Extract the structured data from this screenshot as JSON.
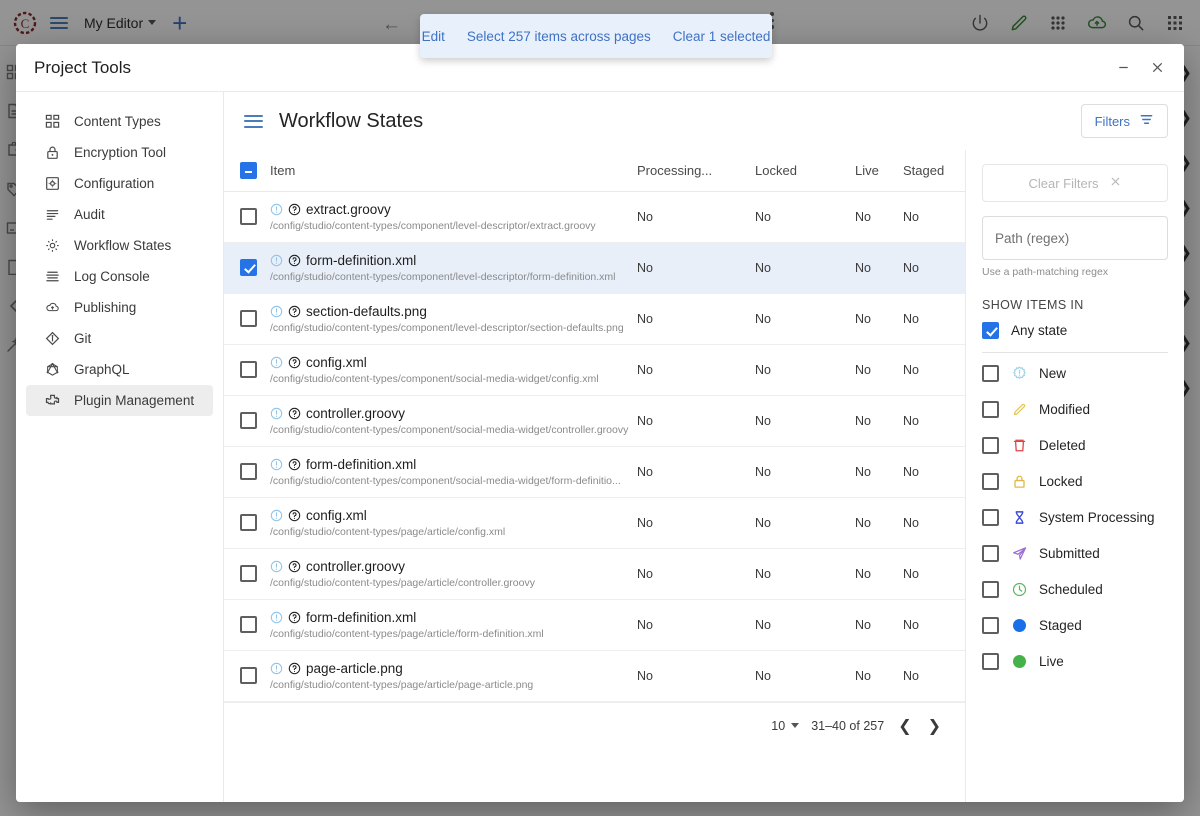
{
  "background": {
    "brand_icon": "crafter-logo-icon",
    "menu_icon": "hamburger-icon",
    "editor_label": "My Editor",
    "add_label": "+",
    "back_icon": "arrow-left-icon",
    "kebab_icon": "more-vertical-icon",
    "top_icons": [
      "power-icon",
      "pencil-icon",
      "grid-dots-icon",
      "cloud-upload-icon",
      "search-icon",
      "apps-grid-icon"
    ],
    "left_rail_icons": [
      "dashboard-icon",
      "document-icon",
      "puzzle-icon",
      "tag-icon",
      "card-icon",
      "page-icon",
      "chevron-left-icon",
      "wand-icon"
    ],
    "right_rail_icons": [
      "chevron-right-icon",
      "chevron-right-icon",
      "chevron-right-icon",
      "chevron-right-icon",
      "chevron-right-icon",
      "chevron-right-icon",
      "chevron-right-icon",
      "chevron-right-icon"
    ],
    "accent_blue": "#3f72c4",
    "accent_green": "#4a8a4a"
  },
  "bulk_toast": {
    "edit_label": "Edit",
    "select_all_label": "Select 257 items across pages",
    "clear_label": "Clear 1 selected",
    "background": "#e8f0fb",
    "text_color": "#3f72c4"
  },
  "dialog": {
    "title": "Project Tools",
    "minimize_label": "–",
    "close_label": "✕"
  },
  "sidebar": {
    "items": [
      {
        "label": "Content Types",
        "icon": "content-types-icon",
        "active": false
      },
      {
        "label": "Encryption Tool",
        "icon": "lock-icon",
        "active": false
      },
      {
        "label": "Configuration",
        "icon": "settings-square-icon",
        "active": false
      },
      {
        "label": "Audit",
        "icon": "list-icon",
        "active": false
      },
      {
        "label": "Workflow States",
        "icon": "gear-icon",
        "active": false
      },
      {
        "label": "Log Console",
        "icon": "log-lines-icon",
        "active": false
      },
      {
        "label": "Publishing",
        "icon": "cloud-upload-icon",
        "active": false
      },
      {
        "label": "Git",
        "icon": "git-diamond-icon",
        "active": false
      },
      {
        "label": "GraphQL",
        "icon": "graphql-icon",
        "active": false
      },
      {
        "label": "Plugin Management",
        "icon": "plugin-puzzle-icon",
        "active": true
      }
    ]
  },
  "main": {
    "menu_icon": "hamburger-icon",
    "title": "Workflow States",
    "filters_button": {
      "label": "Filters",
      "icon": "filter-icon"
    }
  },
  "table": {
    "header_checkbox_state": "indeterminate",
    "columns": [
      "Item",
      "Processing...",
      "Locked",
      "Live",
      "Staged"
    ],
    "rows": [
      {
        "name": "extract.groovy",
        "path": "/config/studio/content-types/component/level-descriptor/extract.groovy",
        "processing": "No",
        "locked": "No",
        "live": "No",
        "staged": "No",
        "selected": false
      },
      {
        "name": "form-definition.xml",
        "path": "/config/studio/content-types/component/level-descriptor/form-definition.xml",
        "processing": "No",
        "locked": "No",
        "live": "No",
        "staged": "No",
        "selected": true
      },
      {
        "name": "section-defaults.png",
        "path": "/config/studio/content-types/component/level-descriptor/section-defaults.png",
        "processing": "No",
        "locked": "No",
        "live": "No",
        "staged": "No",
        "selected": false
      },
      {
        "name": "config.xml",
        "path": "/config/studio/content-types/component/social-media-widget/config.xml",
        "processing": "No",
        "locked": "No",
        "live": "No",
        "staged": "No",
        "selected": false
      },
      {
        "name": "controller.groovy",
        "path": "/config/studio/content-types/component/social-media-widget/controller.groovy",
        "processing": "No",
        "locked": "No",
        "live": "No",
        "staged": "No",
        "selected": false
      },
      {
        "name": "form-definition.xml",
        "path": "/config/studio/content-types/component/social-media-widget/form-definitio...",
        "processing": "No",
        "locked": "No",
        "live": "No",
        "staged": "No",
        "selected": false
      },
      {
        "name": "config.xml",
        "path": "/config/studio/content-types/page/article/config.xml",
        "processing": "No",
        "locked": "No",
        "live": "No",
        "staged": "No",
        "selected": false
      },
      {
        "name": "controller.groovy",
        "path": "/config/studio/content-types/page/article/controller.groovy",
        "processing": "No",
        "locked": "No",
        "live": "No",
        "staged": "No",
        "selected": false
      },
      {
        "name": "form-definition.xml",
        "path": "/config/studio/content-types/page/article/form-definition.xml",
        "processing": "No",
        "locked": "No",
        "live": "No",
        "staged": "No",
        "selected": false
      },
      {
        "name": "page-article.png",
        "path": "/config/studio/content-types/page/article/page-article.png",
        "processing": "No",
        "locked": "No",
        "live": "No",
        "staged": "No",
        "selected": false
      }
    ],
    "row_icons": [
      "info-circle-icon",
      "help-circle-icon"
    ]
  },
  "pagination": {
    "rows_per_page": "10",
    "range_label": "31–40 of 257",
    "prev_icon": "chevron-left-icon",
    "next_icon": "chevron-right-icon"
  },
  "filter_panel": {
    "clear_filters_label": "Clear Filters",
    "clear_filters_icon": "close-icon",
    "clear_filters_disabled": true,
    "path_placeholder": "Path (regex)",
    "path_value": "",
    "path_help": "Use a path-matching regex",
    "section_label": "SHOW ITEMS IN",
    "states": [
      {
        "label": "Any state",
        "icon": "none",
        "checked": true,
        "color": ""
      },
      {
        "label": "New",
        "icon": "new-burst-icon",
        "checked": false,
        "color": "#9fd2ec"
      },
      {
        "label": "Modified",
        "icon": "pencil-icon",
        "checked": false,
        "color": "#e3c44a"
      },
      {
        "label": "Deleted",
        "icon": "trash-icon",
        "checked": false,
        "color": "#e04545"
      },
      {
        "label": "Locked",
        "icon": "lock-icon",
        "checked": false,
        "color": "#e0b84a"
      },
      {
        "label": "System Processing",
        "icon": "hourglass-icon",
        "checked": false,
        "color": "#3b49d6"
      },
      {
        "label": "Submitted",
        "icon": "paper-plane-icon",
        "checked": false,
        "color": "#9a6fd8"
      },
      {
        "label": "Scheduled",
        "icon": "clock-icon",
        "checked": false,
        "color": "#5cb860"
      },
      {
        "label": "Staged",
        "icon": "filled-circle-icon",
        "checked": false,
        "color": "#1a6ee8"
      },
      {
        "label": "Live",
        "icon": "filled-circle-icon",
        "checked": false,
        "color": "#45b149"
      }
    ]
  }
}
